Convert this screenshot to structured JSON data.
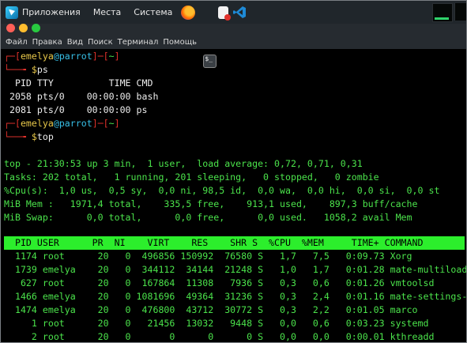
{
  "panel": {
    "menu": [
      "Приложения",
      "Места",
      "Система"
    ],
    "launchers": [
      "firefox-icon",
      "terminal-icon",
      "text-editor-icon",
      "vscode-icon"
    ]
  },
  "window": {
    "menubar": [
      "Файл",
      "Правка",
      "Вид",
      "Поиск",
      "Терминал",
      "Помощь"
    ]
  },
  "terminal": {
    "prompt1": {
      "user": "emelya",
      "at": "@",
      "host": "parrot",
      "dir": "~",
      "cmd": "ps"
    },
    "ps": {
      "header": "  PID TTY          TIME CMD",
      "rows": [
        " 2058 pts/0    00:00:00 bash",
        " 2081 pts/0    00:00:00 ps"
      ]
    },
    "prompt2": {
      "user": "emelya",
      "at": "@",
      "host": "parrot",
      "dir": "~",
      "cmd": "top"
    },
    "top": {
      "summary": [
        "top - 21:30:53 up 3 min,  1 user,  load average: 0,72, 0,71, 0,31",
        "Tasks: 202 total,   1 running, 201 sleeping,   0 stopped,   0 zombie",
        "%Cpu(s):  1,0 us,  0,5 sy,  0,0 ni, 98,5 id,  0,0 wa,  0,0 hi,  0,0 si,  0,0 st",
        "MiB Mem :   1971,4 total,    335,5 free,    913,1 used,    897,3 buff/cache",
        "MiB Swap:      0,0 total,      0,0 free,      0,0 used.   1058,2 avail Mem"
      ],
      "columns_header": "  PID USER      PR  NI    VIRT    RES    SHR S  %CPU  %MEM     TIME+ COMMAND",
      "processes": [
        "  1174 root      20   0  496856 150992  76580 S   1,7   7,5   0:09.73 Xorg",
        "  1739 emelya    20   0  344112  34144  21248 S   1,0   1,7   0:01.28 mate-multiload-",
        "   627 root      20   0  167864  11308   7936 S   0,3   0,6   0:01.26 vmtoolsd",
        "  1466 emelya    20   0 1081696  49364  31236 S   0,3   2,4   0:01.16 mate-settings-d",
        "  1474 emelya    20   0  476800  43712  30772 S   0,3   2,2   0:01.05 marco",
        "     1 root      20   0   21456  13032   9448 S   0,0   0,6   0:03.23 systemd",
        "     2 root      20   0       0      0      0 S   0,0   0,0   0:00.01 kthreadd"
      ]
    }
  }
}
